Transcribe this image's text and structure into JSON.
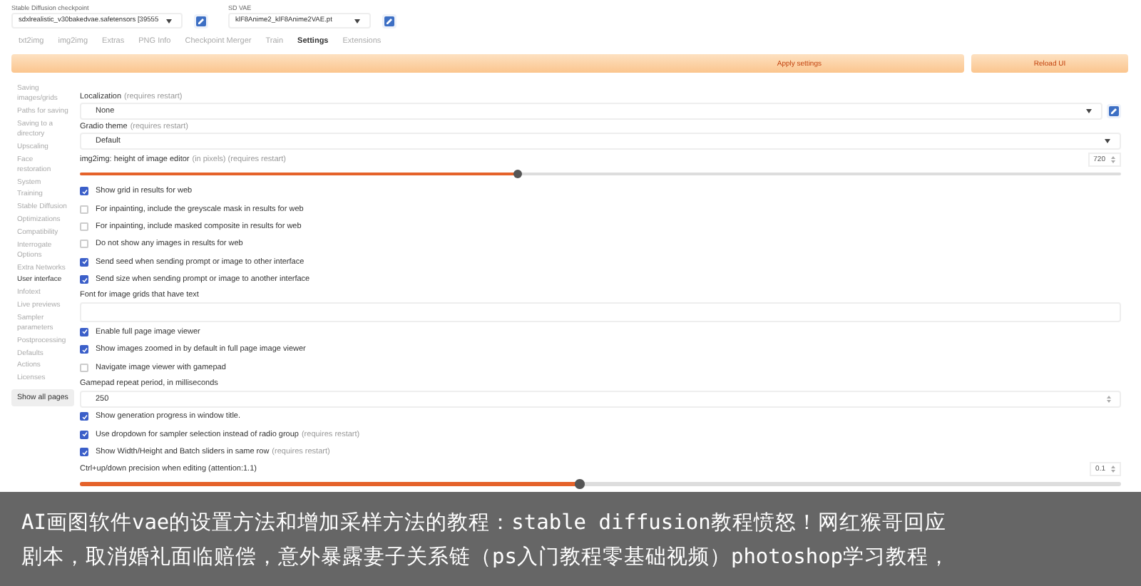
{
  "checkpoint": {
    "label": "Stable Diffusion checkpoint",
    "value": "sdxlrealistic_v30bakedvae.safetensors [39555"
  },
  "vae": {
    "label": "SD VAE",
    "value": "klF8Anime2_klF8Anime2VAE.pt"
  },
  "tabs": [
    {
      "label": "txt2img",
      "selected": false
    },
    {
      "label": "img2img",
      "selected": false
    },
    {
      "label": "Extras",
      "selected": false
    },
    {
      "label": "PNG Info",
      "selected": false
    },
    {
      "label": "Checkpoint Merger",
      "selected": false
    },
    {
      "label": "Train",
      "selected": false
    },
    {
      "label": "Settings",
      "selected": true
    },
    {
      "label": "Extensions",
      "selected": false
    }
  ],
  "buttons": {
    "apply": "Apply settings",
    "reload": "Reload UI"
  },
  "sidebar": {
    "items": [
      {
        "label": "Saving images/grids",
        "selected": false
      },
      {
        "label": "Paths for saving",
        "selected": false
      },
      {
        "label": "Saving to a directory",
        "selected": false
      },
      {
        "label": "Upscaling",
        "selected": false
      },
      {
        "label": "Face restoration",
        "selected": false
      },
      {
        "label": "System",
        "selected": false
      },
      {
        "label": "Training",
        "selected": false
      },
      {
        "label": "Stable Diffusion",
        "selected": false
      },
      {
        "label": "Optimizations",
        "selected": false
      },
      {
        "label": "Compatibility",
        "selected": false
      },
      {
        "label": "Interrogate Options",
        "selected": false
      },
      {
        "label": "Extra Networks",
        "selected": false
      },
      {
        "label": "User interface",
        "selected": true
      },
      {
        "label": "Infotext",
        "selected": false
      },
      {
        "label": "Live previews",
        "selected": false
      },
      {
        "label": "Sampler parameters",
        "selected": false
      },
      {
        "label": "Postprocessing",
        "selected": false
      },
      {
        "label": "Defaults",
        "selected": false
      },
      {
        "label": "Actions",
        "selected": false
      },
      {
        "label": "Licenses",
        "selected": false
      }
    ],
    "show_all": "Show all pages"
  },
  "settings": [
    {
      "kind": "dropdown",
      "label": "Localization",
      "note": "(requires restart)",
      "value": "None",
      "refresh_button": true
    },
    {
      "kind": "dropdown",
      "label": "Gradio theme",
      "note": "(requires restart)",
      "value": "Default",
      "refresh_button": false
    },
    {
      "kind": "slider",
      "label": "img2img: height of image editor",
      "note": "(in pixels) (requires restart)",
      "value": "720",
      "level": 0.42
    },
    {
      "kind": "checkbox",
      "label": "Show grid in results for web",
      "checked": true
    },
    {
      "kind": "checkbox",
      "label": "For inpainting, include the greyscale mask in results for web",
      "checked": false
    },
    {
      "kind": "checkbox",
      "label": "For inpainting, include masked composite in results for web",
      "checked": false
    },
    {
      "kind": "checkbox",
      "label": "Do not show any images in results for web",
      "checked": false
    },
    {
      "kind": "checkbox",
      "label": "Send seed when sending prompt or image to other interface",
      "checked": true
    },
    {
      "kind": "checkbox",
      "label": "Send size when sending prompt or image to another interface",
      "checked": true
    },
    {
      "kind": "textarea",
      "label": "Font for image grids that have text"
    },
    {
      "kind": "checkbox",
      "label": "Enable full page image viewer",
      "checked": true
    },
    {
      "kind": "checkbox",
      "label": "Show images zoomed in by default in full page image viewer",
      "checked": true
    },
    {
      "kind": "checkbox",
      "label": "Navigate image viewer with gamepad",
      "checked": false
    },
    {
      "kind": "number",
      "label": "Gamepad repeat period, in milliseconds",
      "value": "250"
    },
    {
      "kind": "checkbox",
      "label": "Show generation progress in window title.",
      "checked": true
    },
    {
      "kind": "checkbox",
      "label": "Use dropdown for sampler selection instead of radio group",
      "note": "(requires restart)",
      "checked": true
    },
    {
      "kind": "checkbox",
      "label": "Show Width/Height and Batch sliders in same row",
      "note": "(requires restart)",
      "checked": true
    },
    {
      "kind": "slider",
      "label": "Ctrl+up/down precision when editing (attention:1.1)",
      "value": "0.1",
      "level": 0.48
    }
  ],
  "overlay_caption": {
    "lines": [
      "AI画图软件vae的设置方法和增加采样方法的教程：stable diffusion教程愤怒！网红猴哥回应",
      "剧本，取消婚礼面临赔偿，意外暴露妻子关系链（ps入门教程零基础视频）photoshop学习教程，"
    ]
  }
}
